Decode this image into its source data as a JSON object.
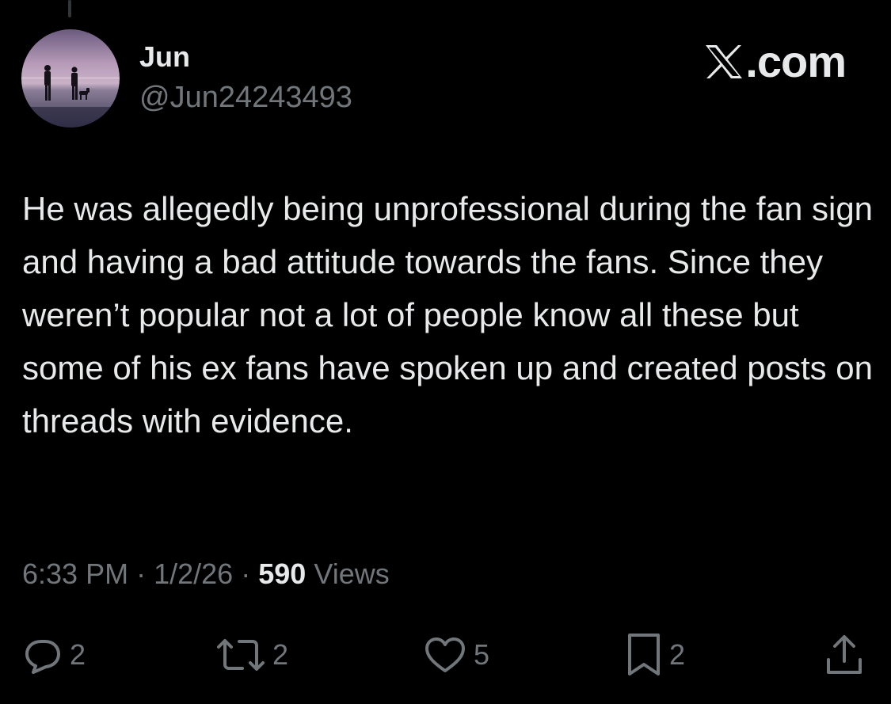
{
  "colors": {
    "background": "#000000",
    "primary_text": "#e7e9ea",
    "secondary_text": "#71767b"
  },
  "author": {
    "display_name": "Jun",
    "handle": "@Jun24243493",
    "avatar_icon": "beach-sunset-silhouettes-avatar"
  },
  "brand": {
    "icon": "x-logo-icon",
    "text": ".com"
  },
  "tweet": {
    "text": "He was allegedly being unprofessional during the fan sign and having a bad attitude towards the fans. Since they weren’t popular not a lot of people know all these but some of his ex fans have spoken up and created posts on threads with evidence."
  },
  "meta": {
    "time": "6:33 PM",
    "separator": "·",
    "date": "1/2/26",
    "views_count": "590",
    "views_label": "Views"
  },
  "actions": {
    "reply": {
      "icon": "reply-icon",
      "count": "2"
    },
    "repost": {
      "icon": "repost-icon",
      "count": "2"
    },
    "like": {
      "icon": "heart-icon",
      "count": "5"
    },
    "bookmark": {
      "icon": "bookmark-icon",
      "count": "2"
    },
    "share": {
      "icon": "share-icon"
    }
  }
}
